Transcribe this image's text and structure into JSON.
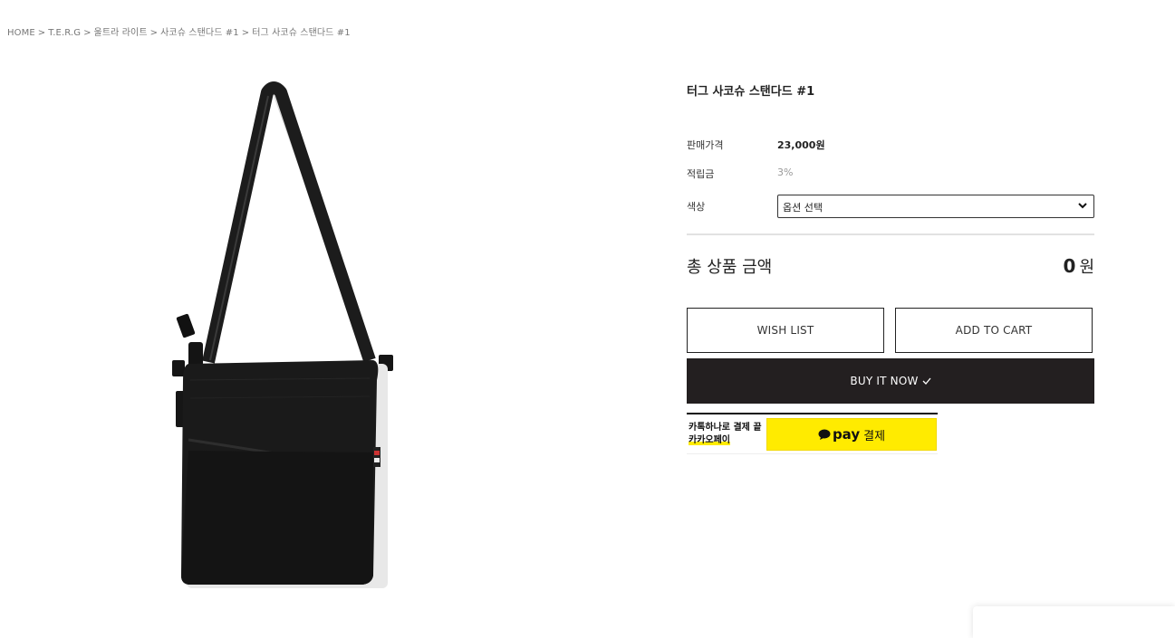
{
  "breadcrumb": {
    "items": [
      "HOME",
      "T.E.R.G",
      "울트라 라이트",
      "사코슈 스탠다드 #1",
      "터그 사코슈 스탠다드 #1"
    ],
    "separator": ">"
  },
  "product": {
    "title": "터그 사코슈 스탠다드 #1",
    "price_label": "판매가격",
    "price_value": "23,000원",
    "points_label": "적립금",
    "points_value": "3%",
    "color_label": "색상",
    "color_select_value": "옵션 선택"
  },
  "total": {
    "label": "총 상품 금액",
    "amount": "0",
    "unit": "원"
  },
  "buttons": {
    "wish_list": "WISH LIST",
    "add_to_cart": "ADD TO CART",
    "buy_now": "BUY IT NOW"
  },
  "kakaopay": {
    "line1": "카톡하나로 결제 끝",
    "line2": "카카오페이",
    "pay_brand": "pay",
    "pay_label": "결제"
  },
  "colors": {
    "buy_button_bg": "#231f20",
    "kakao_yellow": "#ffeb00",
    "bag_black": "#1a1a1a"
  }
}
